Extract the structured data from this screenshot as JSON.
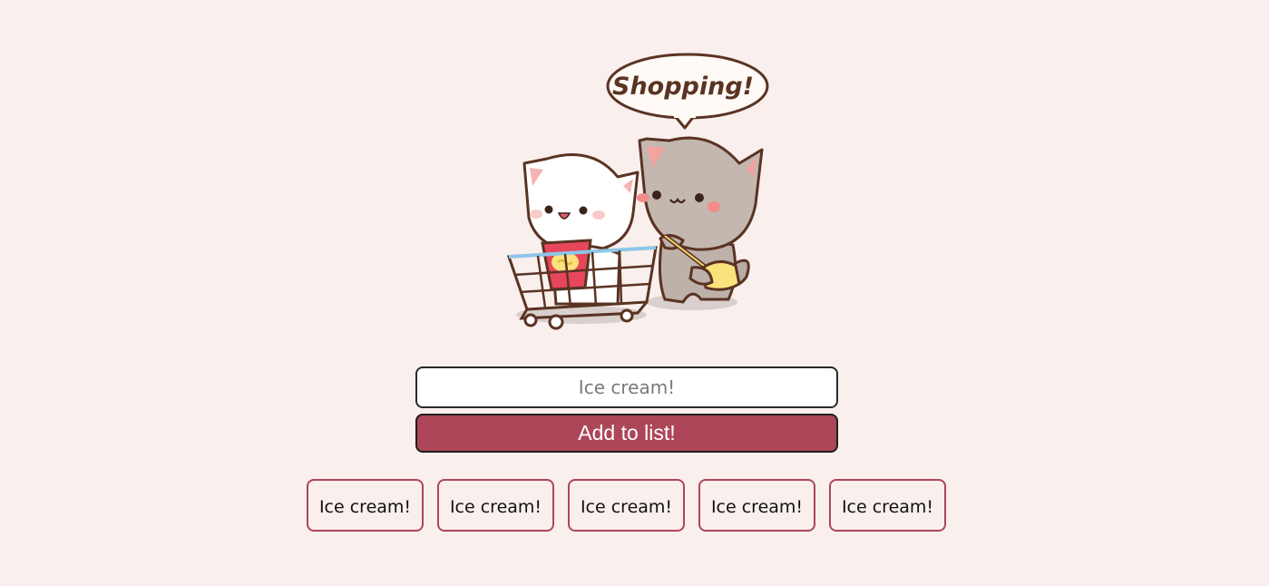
{
  "illustration": {
    "speech_bubble_text": "Shopping!",
    "description_icon": "two-cats-shopping-cart-icon"
  },
  "form": {
    "input_placeholder": "Ice cream!",
    "input_value": "",
    "add_button_label": "Add to list!"
  },
  "list": {
    "items": [
      {
        "label": "Ice cream!"
      },
      {
        "label": "Ice cream!"
      },
      {
        "label": "Ice cream!"
      },
      {
        "label": "Ice cream!"
      },
      {
        "label": "Ice cream!"
      }
    ]
  },
  "colors": {
    "background": "#f9efed",
    "accent": "#ad4659",
    "outline": "#5a3323"
  }
}
